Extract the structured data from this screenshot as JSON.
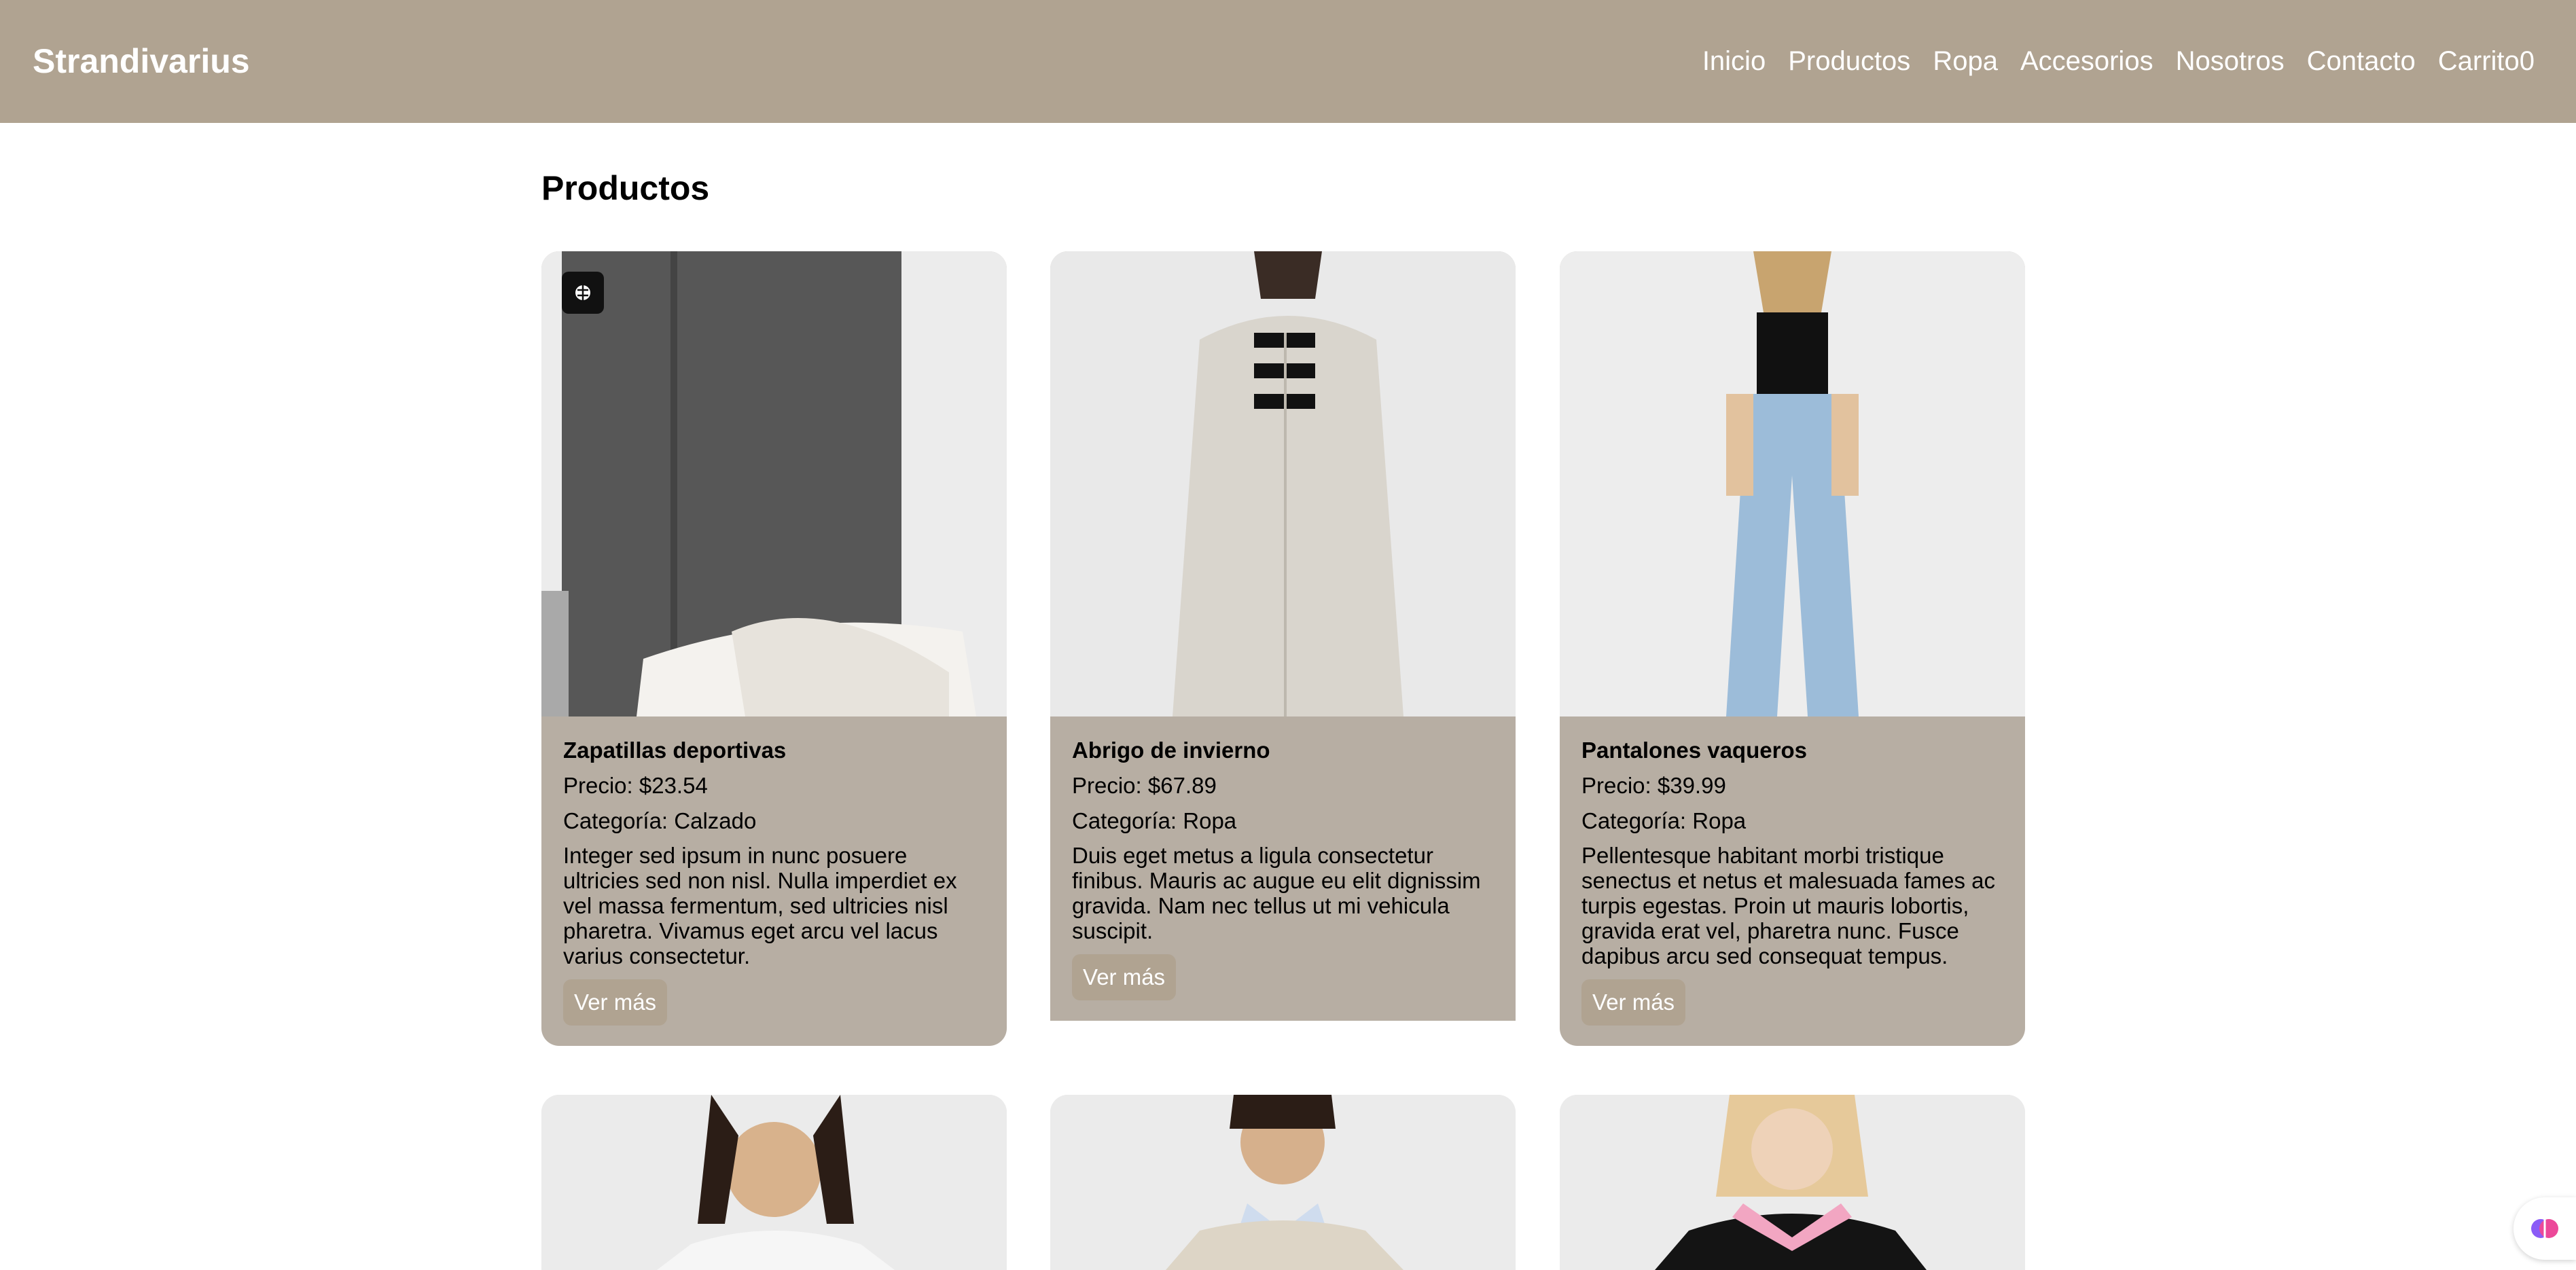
{
  "header": {
    "brand": "Strandivarius",
    "nav": [
      "Inicio",
      "Productos",
      "Ropa",
      "Accesorios",
      "Nosotros",
      "Contacto",
      "Carrito0"
    ]
  },
  "main": {
    "title": "Productos",
    "products": [
      {
        "name": "Zapatillas deportivas",
        "price": "Precio: $23.54",
        "category": "Categoría: Calzado",
        "description": "Integer sed ipsum in nunc posuere ultricies sed non nisl. Nulla imperdiet ex vel massa fermentum, sed ultricies nisl pharetra. Vivamus eget arcu vel lacus varius consectetur.",
        "button": "Ver más"
      },
      {
        "name": "Abrigo de invierno",
        "price": "Precio: $67.89",
        "category": "Categoría: Ropa",
        "description": "Duis eget metus a ligula consectetur finibus. Mauris ac augue eu elit dignissim gravida. Nam nec tellus ut mi vehicula suscipit.",
        "button": "Ver más"
      },
      {
        "name": "Pantalones vaqueros",
        "price": "Precio: $39.99",
        "category": "Categoría: Ropa",
        "description": "Pellentesque habitant morbi tristique senectus et netus et malesuada fames ac turpis egestas. Proin ut mauris lobortis, gravida erat vel, pharetra nunc. Fusce dapibus arcu sed consequat tempus.",
        "button": "Ver más"
      }
    ]
  },
  "colors": {
    "header_bg": "#b0a391",
    "card_bg": "#b7aea3",
    "button_bg": "#b0a391"
  },
  "icons": {
    "overlay_badge": "brain-icon",
    "floating_button": "brain-icon"
  }
}
